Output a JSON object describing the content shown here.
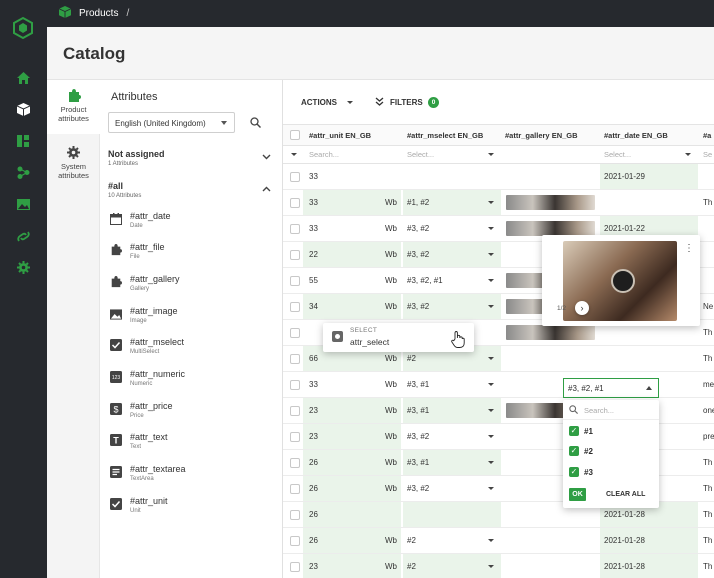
{
  "breadcrumb": {
    "root": "Products",
    "separator": "/"
  },
  "page": {
    "title": "Catalog"
  },
  "left_tabs": [
    {
      "label_1": "Product",
      "label_2": "attributes",
      "icon": "puzzle-icon"
    },
    {
      "label_1": "System",
      "label_2": "attributes",
      "icon": "gear-icon"
    }
  ],
  "attributes_panel": {
    "title": "Attributes",
    "language": "English (United Kingdom)",
    "groups": [
      {
        "name": "Not assigned",
        "count": "1 Attributes"
      },
      {
        "name": "#all",
        "count": "10 Attributes"
      }
    ],
    "items": [
      {
        "name": "#attr_date",
        "type": "Date",
        "icon": "calendar-icon"
      },
      {
        "name": "#attr_file",
        "type": "File",
        "icon": "puzzle-icon"
      },
      {
        "name": "#attr_gallery",
        "type": "Gallery",
        "icon": "puzzle-icon"
      },
      {
        "name": "#attr_image",
        "type": "Image",
        "icon": "image-icon"
      },
      {
        "name": "#attr_mselect",
        "type": "MultiSelect",
        "icon": "checkbox-icon"
      },
      {
        "name": "#attr_numeric",
        "type": "Numeric",
        "icon": "numeric-icon"
      },
      {
        "name": "#attr_price",
        "type": "Price",
        "icon": "dollar-icon"
      },
      {
        "name": "#attr_text",
        "type": "Text",
        "icon": "text-icon"
      },
      {
        "name": "#attr_textarea",
        "type": "TextArea",
        "icon": "textarea-icon"
      },
      {
        "name": "#attr_unit",
        "type": "Unit",
        "icon": "checkbox-icon"
      }
    ]
  },
  "grid": {
    "actions_label": "ACTIONS",
    "filters_label": "FILTERS",
    "filters_count": "0",
    "columns": [
      "#attr_unit EN_GB",
      "#attr_mselect EN_GB",
      "#attr_gallery EN_GB",
      "#attr_date EN_GB",
      "#a"
    ],
    "filter_placeholders": [
      "Search...",
      "Select...",
      "",
      "Select...",
      "Se"
    ],
    "rows": [
      {
        "unit": "33",
        "suffix": "",
        "mselect": "",
        "date": "2021-01-29",
        "extra": ""
      },
      {
        "unit": "33",
        "suffix": "Wb",
        "mselect": "#1, #2",
        "date": "",
        "extra": "Th"
      },
      {
        "unit": "33",
        "suffix": "Wb",
        "mselect": "#3, #2",
        "date": "2021-01-22",
        "extra": ""
      },
      {
        "unit": "22",
        "suffix": "Wb",
        "mselect": "#3, #2",
        "date": "",
        "extra": ""
      },
      {
        "unit": "55",
        "suffix": "Wb",
        "mselect": "#3, #2, #1",
        "date": "",
        "extra": ""
      },
      {
        "unit": "34",
        "suffix": "Wb",
        "mselect": "#3, #2",
        "date": "",
        "extra": "Ne"
      },
      {
        "unit": "",
        "suffix": "",
        "mselect": "",
        "date": "",
        "extra": "Th"
      },
      {
        "unit": "66",
        "suffix": "Wb",
        "mselect": "#2",
        "date": "",
        "extra": "Th"
      },
      {
        "unit": "33",
        "suffix": "Wb",
        "mselect": "#3, #1",
        "date": "",
        "extra": "me"
      },
      {
        "unit": "23",
        "suffix": "Wb",
        "mselect": "#3, #1",
        "date": "",
        "extra": "one"
      },
      {
        "unit": "23",
        "suffix": "Wb",
        "mselect": "#3, #2",
        "date": "",
        "extra": "pre"
      },
      {
        "unit": "26",
        "suffix": "Wb",
        "mselect": "#3, #1",
        "date": "",
        "extra": "Th"
      },
      {
        "unit": "26",
        "suffix": "Wb",
        "mselect": "#3, #2",
        "date": "",
        "extra": "Th"
      },
      {
        "unit": "26",
        "suffix": "",
        "mselect": "",
        "date": "2021-01-28",
        "extra": "Th"
      },
      {
        "unit": "26",
        "suffix": "Wb",
        "mselect": "#2",
        "date": "2021-01-28",
        "extra": "Th"
      },
      {
        "unit": "23",
        "suffix": "Wb",
        "mselect": "#2",
        "date": "2021-01-28",
        "extra": "Th"
      }
    ]
  },
  "gallery_preview": {
    "counter": "1/2"
  },
  "drag_ghost": {
    "type": "SELECT",
    "name": "attr_select"
  },
  "mselect_editor": {
    "value": "#3, #2, #1",
    "search_placeholder": "Search...",
    "options": [
      "#1",
      "#2",
      "#3"
    ],
    "ok_label": "OK",
    "clear_label": "CLEAR ALL"
  },
  "colors": {
    "dark": "#26292e",
    "accent": "#2f9e44",
    "highlight": "#eaf4ea"
  }
}
